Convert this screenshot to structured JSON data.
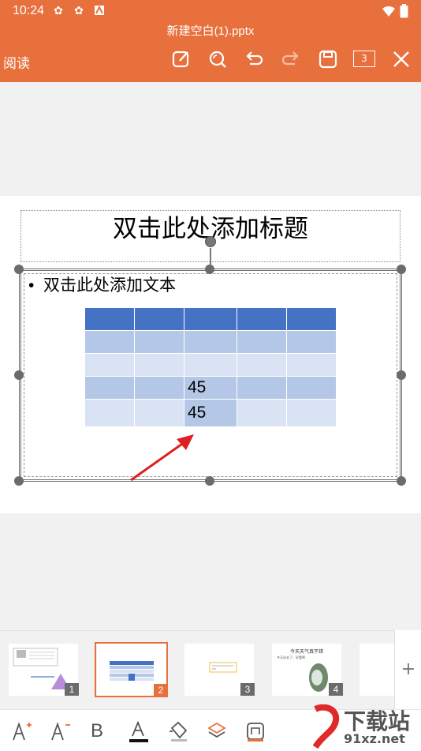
{
  "status": {
    "time": "10:24"
  },
  "header": {
    "doc_title": "新建空白(1).pptx",
    "read_label": "阅读",
    "page_count": "3",
    "toolbar": [
      "edit-icon",
      "search-icon",
      "undo-icon",
      "redo-icon",
      "save-icon",
      "page-count",
      "close-icon"
    ]
  },
  "slide": {
    "title_placeholder": "双击此处添加标题",
    "bullet_text": "双击此处添加文本",
    "table": {
      "rows": [
        [
          "",
          "",
          "",
          "",
          ""
        ],
        [
          "",
          "",
          "",
          "",
          ""
        ],
        [
          "",
          "",
          "",
          "",
          ""
        ],
        [
          "",
          "",
          "45",
          "",
          ""
        ],
        [
          "",
          "",
          "45",
          "",
          ""
        ]
      ]
    }
  },
  "thumbnails": [
    {
      "num": "1",
      "selected": false
    },
    {
      "num": "2",
      "selected": true
    },
    {
      "num": "3",
      "selected": false
    },
    {
      "num": "4",
      "selected": false,
      "title": "今天天气真不错",
      "bullet": "今天出去了，好看啊"
    }
  ],
  "bottom_toolbar": [
    "font-size-increase-icon",
    "font-size-decrease-icon",
    "bold-icon",
    "font-color-icon",
    "fill-color-icon",
    "layers-icon",
    "shape-format-icon"
  ],
  "bold_label": "B",
  "watermark": {
    "text": "下载站",
    "sub": "91xz.net"
  },
  "colors": {
    "accent": "#e8703d",
    "table_header": "#4472c4",
    "table_band1": "#b4c7e7",
    "table_band2": "#dae3f3"
  }
}
